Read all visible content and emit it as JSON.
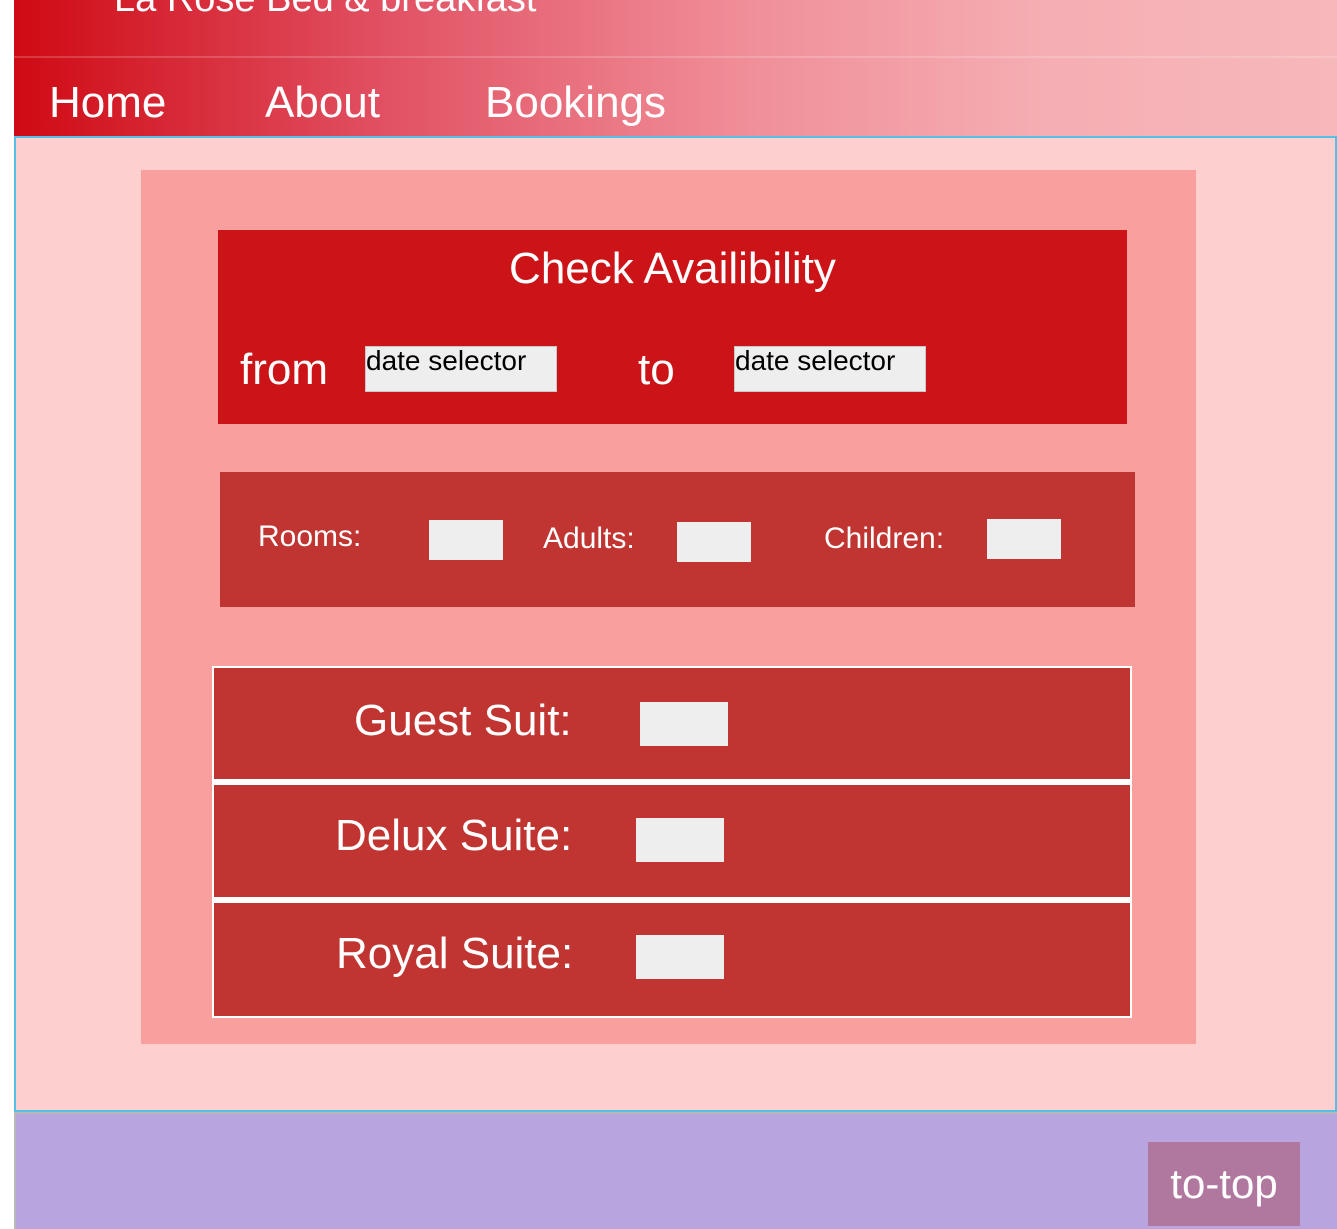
{
  "header": {
    "site_title": "La Rose Bed & breakfast",
    "nav": [
      {
        "label": "Home"
      },
      {
        "label": "About"
      },
      {
        "label": "Bookings"
      }
    ]
  },
  "availability": {
    "title": "Check Availibility",
    "from_label": "from",
    "to_label": "to",
    "from_value": "date selector",
    "to_value": "date selector"
  },
  "guests": {
    "rooms_label": "Rooms:",
    "adults_label": "Adults:",
    "children_label": "Children:"
  },
  "suites": [
    {
      "label": "Guest Suit:"
    },
    {
      "label": "Delux Suite:"
    },
    {
      "label": "Royal Suite:"
    }
  ],
  "footer": {
    "to_top_label": "to-top"
  },
  "colors": {
    "header_red": "#cf0a14",
    "content_bg": "#fdd0cf",
    "panel_bg": "#f9a09f",
    "availability_bg": "#cc1418",
    "section_bg": "#c03431",
    "input_bg": "#eeeeee",
    "footer_bg": "#b8a5df",
    "to_top_bg": "#b0779f",
    "content_border": "#56bfe8"
  }
}
